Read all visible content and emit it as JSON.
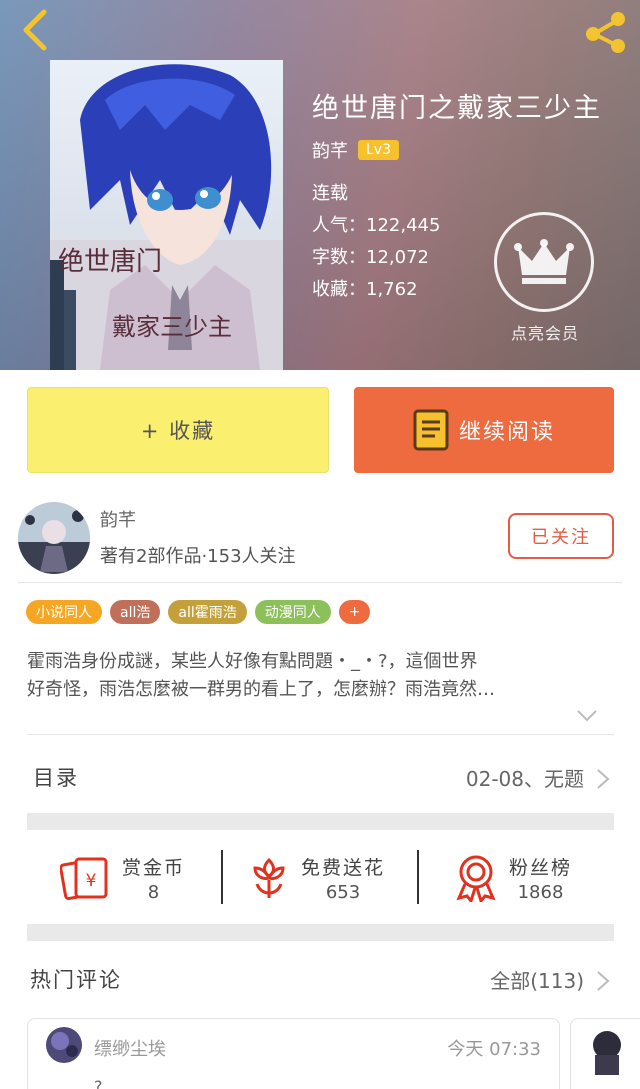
{
  "header": {
    "book_title": "绝世唐门之戴家三少主",
    "author": "韵芊",
    "level": "Lv3",
    "status": "连载",
    "popularity": "人气：122,445",
    "word_count": "字数：12,072",
    "favorites": "收藏：1,762",
    "vip_label": "点亮会员",
    "cover_text_line1": "绝世唐门",
    "cover_text_line2": "戴家三少主",
    "icons": {
      "back": "chevron-left-icon",
      "share": "share-icon",
      "vip": "crown-icon"
    }
  },
  "buttons": {
    "collect": "+ 收藏",
    "read": "继续阅读"
  },
  "author_card": {
    "name": "韵芊",
    "info": "著有2部作品·153人关注",
    "follow": "已关注"
  },
  "tags": [
    {
      "label": "小说同人",
      "color": "#f5a623"
    },
    {
      "label": "all浩",
      "color": "#c0705a"
    },
    {
      "label": "all霍雨浩",
      "color": "#c4a03a"
    },
    {
      "label": "动漫同人",
      "color": "#8cc05a"
    },
    {
      "label": "+",
      "color": "#ee6a3f"
    }
  ],
  "description": {
    "line1": "霍雨浩身份成謎，某些人好像有點問題・_・?，這個世界",
    "line2": "好奇怪，雨浩怎麼被一群男的看上了，怎麼辦？雨浩竟然…"
  },
  "toc": {
    "title": "目录",
    "latest": "02-08、无题"
  },
  "actions": [
    {
      "label": "赏金币",
      "value": "8",
      "icon": "red-envelope-icon",
      "color": "#e0321f"
    },
    {
      "label": "免费送花",
      "value": "653",
      "icon": "flower-icon",
      "color": "#e0321f"
    },
    {
      "label": "粉丝榜",
      "value": "1868",
      "icon": "ribbon-medal-icon",
      "color": "#e0321f"
    }
  ],
  "comments": {
    "title": "热门评论",
    "all": "全部(113)",
    "first": {
      "user": "缥缈尘埃",
      "time": "今天 07:33",
      "body": "?"
    }
  }
}
